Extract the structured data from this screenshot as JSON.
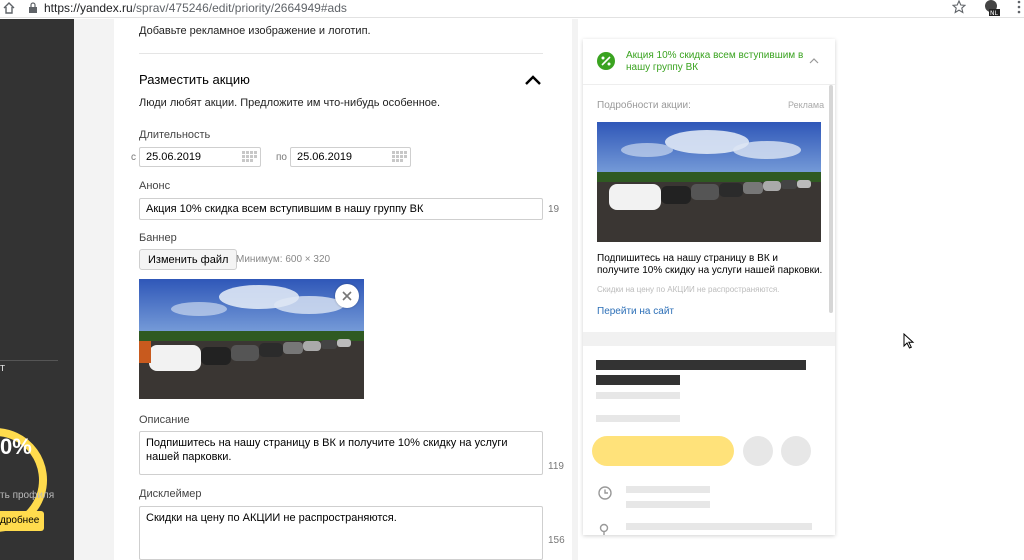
{
  "browser": {
    "url_host": "https://yandex.ru",
    "url_path": "/sprav/475246/edit/priority/2664949#ads",
    "ext_badge": "NL"
  },
  "sidebar": {
    "letter": "т",
    "gauge_value": "0%",
    "gauge_fraction": 0.6,
    "profile_text": "ть профиля",
    "more_button": "дробнее",
    "accent": "#ffdb4d"
  },
  "form": {
    "hint_top": "Добавьте рекламное изображение и логотип.",
    "section_title": "Разместить акцию",
    "section_subtitle": "Люди любят акции. Предложите им что-нибудь особенное.",
    "duration": {
      "label": "Длительность",
      "from_prefix": "с",
      "from_value": "25.06.2019",
      "to_prefix": "по",
      "to_value": "25.06.2019"
    },
    "announce": {
      "label": "Анонс",
      "value": "Акция 10% скидка всем вступившим в нашу группу ВК",
      "counter": "19"
    },
    "banner": {
      "label": "Баннер",
      "change_button": "Изменить файл",
      "min_size": "Минимум: 600 × 320"
    },
    "description": {
      "label": "Описание",
      "value": "Подпишитесь на нашу страницу в ВК и получите 10% скидку на услуги нашей парковки.",
      "counter": "119"
    },
    "disclaimer": {
      "label": "Дисклеймер",
      "value": "Скидки на цену по АКЦИИ не распространяются.",
      "counter": "156"
    }
  },
  "preview": {
    "title": "Акция 10% скидка всем вступившим в нашу группу ВК",
    "details_label": "Подробности акции:",
    "ad_label": "Реклама",
    "description": "Подпишитесь на нашу страницу в ВК и получите 10% скидку на услуги нашей парковки.",
    "disclaimer": "Скидки на цену по АКЦИИ не распространяются.",
    "link": "Перейти на сайт",
    "accent": "#3aa320",
    "link_color": "#2c6fb7"
  }
}
